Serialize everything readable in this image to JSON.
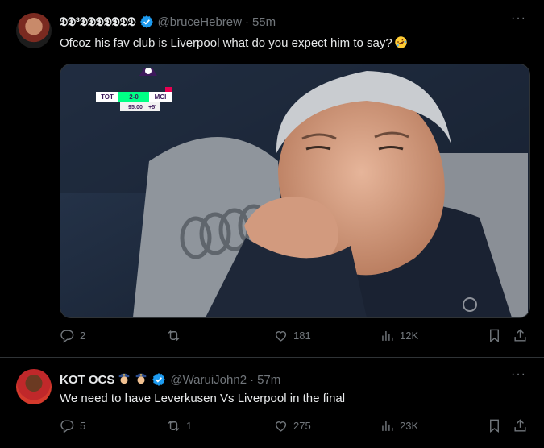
{
  "tweets": [
    {
      "display_name": "𝕯𝕯³𝕯𝕯𝕯𝕯𝕯𝕯𝕯",
      "handle": "@bruceHebrew",
      "separator": "·",
      "time": "55m",
      "more": "···",
      "text": "Ofcoz his fav club is Liverpool what do you expect him to say?",
      "emoji_icon": "rolling-laughing-emoji-icon",
      "media": {
        "scoreboard": {
          "home": "TOT",
          "score": "2-0",
          "away": "MCI",
          "clock": "95:00",
          "added": "+5'"
        },
        "logo_rings": "audi-logo"
      },
      "replies": "2",
      "reposts": "",
      "likes": "181",
      "views": "12K"
    },
    {
      "display_name": "KOT OCS",
      "name_emojis": "police-officer-emoji-icon x2",
      "handle": "@WaruiJohn2",
      "separator": "·",
      "time": "57m",
      "more": "···",
      "text": "We need to have Leverkusen Vs Liverpool in the final",
      "replies": "5",
      "reposts": "1",
      "likes": "275",
      "views": "23K"
    }
  ],
  "colors": {
    "background": "#000000",
    "text": "#e7e9ea",
    "muted": "#71767b",
    "verified": "#1d9bf0",
    "divider": "#2f3336"
  }
}
